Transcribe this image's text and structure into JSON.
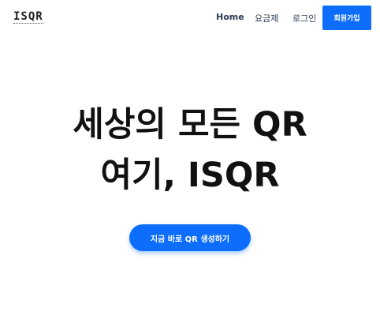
{
  "header": {
    "logo_text": "ISQR",
    "nav": {
      "home": "Home",
      "pricing": "요금제",
      "login": "로그인"
    },
    "signup_label": "회원가입"
  },
  "hero": {
    "title_line1": "세상의 모든 QR",
    "title_line2": "여기, ISQR",
    "cta_label": "지금 바로 QR 생성하기"
  },
  "colors": {
    "accent": "#0d6efd",
    "text": "#111111",
    "nav_text": "#2a3a52",
    "background": "#ffffff"
  }
}
